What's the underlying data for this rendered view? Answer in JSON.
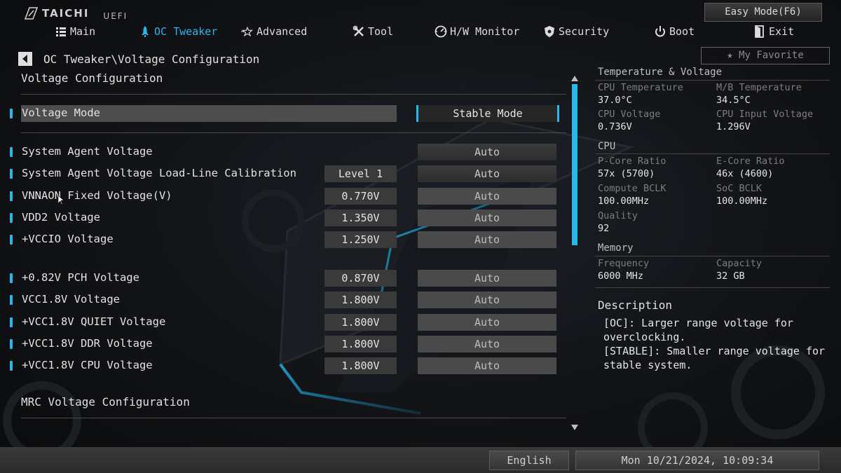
{
  "brand": {
    "name": "TAICHI",
    "suffix": "UEFI"
  },
  "easy_mode_label": "Easy Mode(F6)",
  "nav": [
    {
      "label": "Main",
      "icon": "main-grid-icon",
      "active": false
    },
    {
      "label": "OC Tweaker",
      "icon": "rocket-icon",
      "active": true
    },
    {
      "label": "Advanced",
      "icon": "star-advanced-icon",
      "active": false
    },
    {
      "label": "Tool",
      "icon": "tools-icon",
      "active": false
    },
    {
      "label": "H/W Monitor",
      "icon": "monitor-gauge-icon",
      "active": false
    },
    {
      "label": "Security",
      "icon": "shield-icon",
      "active": false
    },
    {
      "label": "Boot",
      "icon": "power-icon",
      "active": false
    },
    {
      "label": "Exit",
      "icon": "exit-door-icon",
      "active": false
    }
  ],
  "favorite_label": "My Favorite",
  "breadcrumb": "OC Tweaker\\Voltage Configuration",
  "section_title": "Voltage Configuration",
  "voltage_mode": {
    "label": "Voltage Mode",
    "option": "Stable Mode"
  },
  "settings": [
    {
      "label": "System Agent Voltage",
      "current": "",
      "option": "Auto",
      "dim": false
    },
    {
      "label": "System Agent Voltage Load-Line Calibration",
      "current": "Level 1",
      "option": "Auto",
      "dim": false
    },
    {
      "label": "VNNAON Fixed Voltage(V)",
      "current": "0.770V",
      "option": "Auto",
      "dim": true
    },
    {
      "label": "VDD2 Voltage",
      "current": "1.350V",
      "option": "Auto",
      "dim": true
    },
    {
      "label": "+VCCIO Voltage",
      "current": "1.250V",
      "option": "Auto",
      "dim": true
    },
    {
      "label": "+0.82V PCH Voltage",
      "current": "0.870V",
      "option": "Auto",
      "dim": true
    },
    {
      "label": "VCC1.8V Voltage",
      "current": "1.800V",
      "option": "Auto",
      "dim": true
    },
    {
      "label": "+VCC1.8V QUIET Voltage",
      "current": "1.800V",
      "option": "Auto",
      "dim": true
    },
    {
      "label": "+VCC1.8V DDR Voltage",
      "current": "1.800V",
      "option": "Auto",
      "dim": true
    },
    {
      "label": "+VCC1.8V CPU Voltage",
      "current": "1.800V",
      "option": "Auto",
      "dim": true
    }
  ],
  "mrc_title": "MRC Voltage Configuration",
  "panel": {
    "temp_voltage": {
      "heading": "Temperature & Voltage",
      "items": [
        {
          "label": "CPU Temperature",
          "value": "37.0°C"
        },
        {
          "label": "M/B Temperature",
          "value": "34.5°C"
        },
        {
          "label": "CPU Voltage",
          "value": "0.736V"
        },
        {
          "label": "CPU Input Voltage",
          "value": "1.296V"
        }
      ]
    },
    "cpu": {
      "heading": "CPU",
      "items": [
        {
          "label": "P-Core Ratio",
          "value": "57x (5700)"
        },
        {
          "label": "E-Core Ratio",
          "value": "46x (4600)"
        },
        {
          "label": "Compute BCLK",
          "value": "100.00MHz"
        },
        {
          "label": "SoC BCLK",
          "value": "100.00MHz"
        },
        {
          "label": "Quality",
          "value": "92"
        }
      ]
    },
    "memory": {
      "heading": "Memory",
      "items": [
        {
          "label": "Frequency",
          "value": "6000 MHz"
        },
        {
          "label": "Capacity",
          "value": "32 GB"
        }
      ]
    }
  },
  "description": {
    "title": "Description",
    "lines": [
      "[OC]: Larger range voltage for",
      "overclocking.",
      "[STABLE]: Smaller range voltage for",
      "stable system."
    ]
  },
  "footer": {
    "language": "English",
    "datetime": "Mon 10/21/2024, 10:09:34"
  },
  "colors": {
    "accent": "#2bb6e8"
  }
}
